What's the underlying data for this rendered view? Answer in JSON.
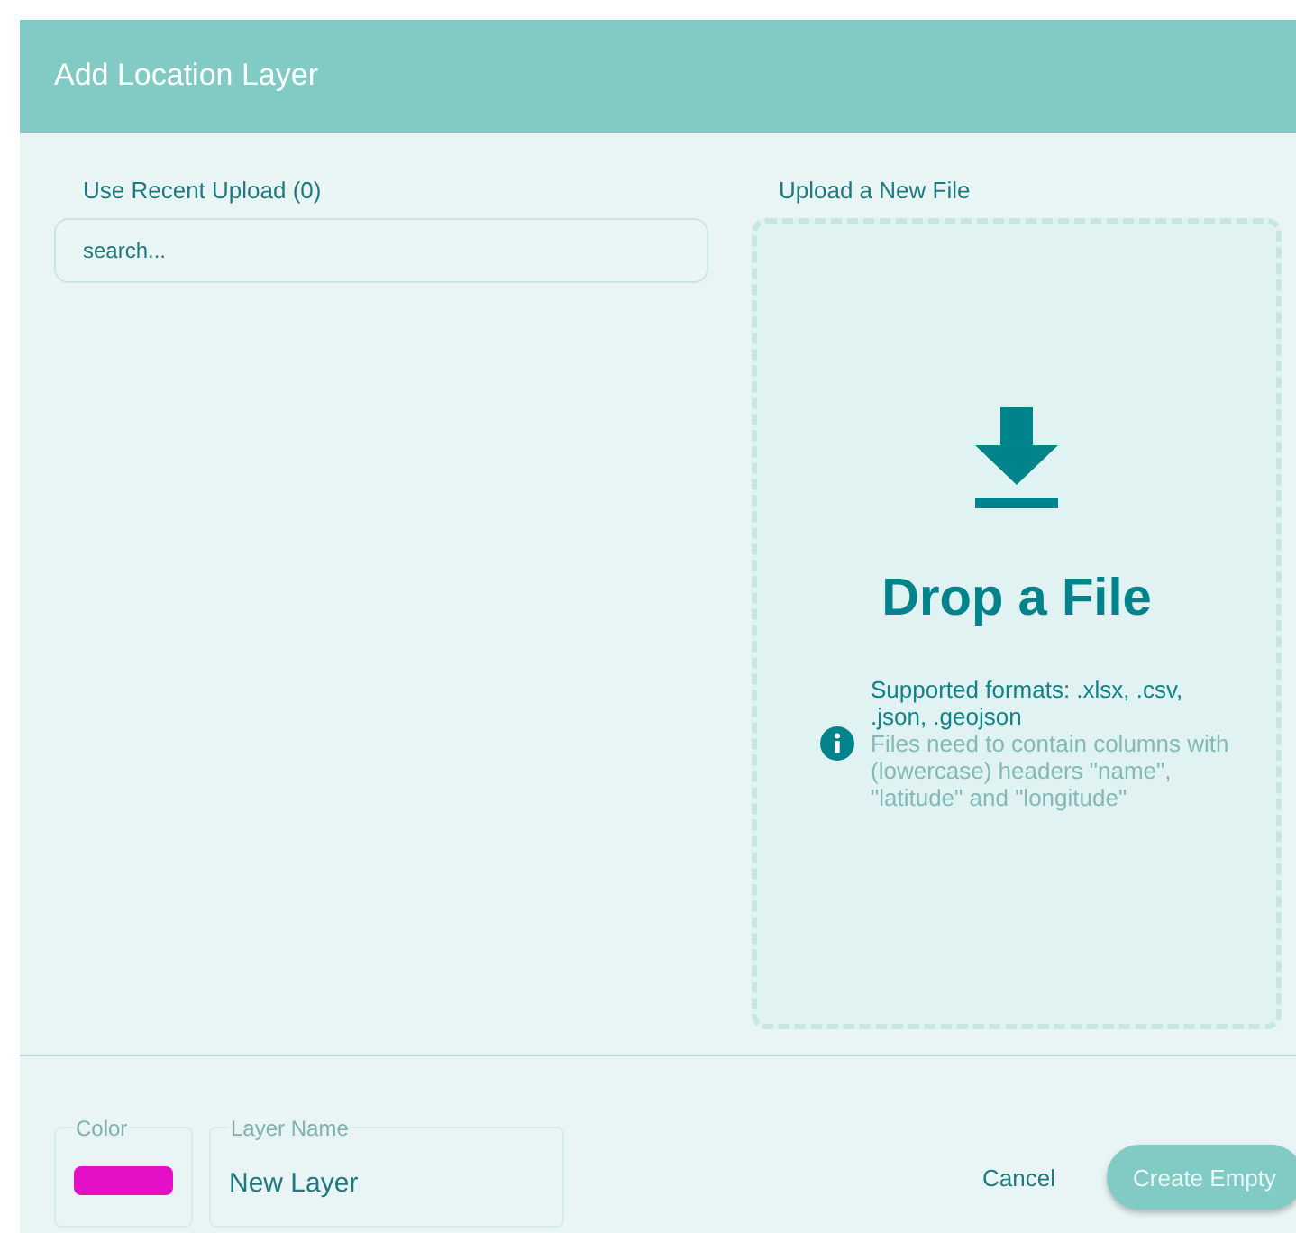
{
  "dialog": {
    "title": "Add Location Layer"
  },
  "recent": {
    "label": "Use Recent Upload (0)",
    "search": {
      "placeholder": "search..."
    }
  },
  "upload": {
    "label": "Upload a New File",
    "heading": "Drop a File",
    "formats": "Supported formats: .xlsx, .csv, .json, .geojson",
    "hint": "Files need to contain columns with (lowercase) headers \"name\", \"latitude\" and \"longitude\""
  },
  "footer": {
    "color": {
      "label": "Color",
      "color": "#e60fc8"
    },
    "layer_name": {
      "label": "Layer Name",
      "value": "New Layer"
    },
    "buttons": [
      {
        "label": "Cancel",
        "kind": "text",
        "disabled": false
      },
      {
        "label": "Create Empty",
        "kind": "filled",
        "disabled": true
      }
    ]
  }
}
